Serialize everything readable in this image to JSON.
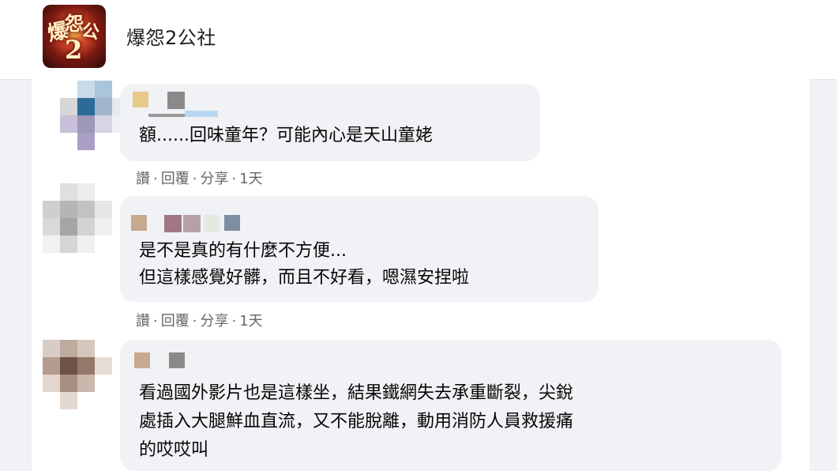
{
  "page": {
    "title": "爆怨2公社",
    "avatar_lettering": "爆怨2公"
  },
  "comments": [
    {
      "text": "額......回味童年？可能內心是天山童姥",
      "actions": {
        "like": "讚",
        "reply": "回覆",
        "share": "分享",
        "time": "1天"
      }
    },
    {
      "text_lines": [
        "是不是真的有什麼不方便...",
        "但這樣感覺好髒，而且不好看，嗯濕安捏啦"
      ],
      "actions": {
        "like": "讚",
        "reply": "回覆",
        "share": "分享",
        "time": "1天"
      }
    },
    {
      "text_lines": [
        "看過國外影片也是這樣坐，結果鐵網失去承重斷裂，尖銳",
        "處插入大腿鮮血直流，又不能脫離，動用消防人員救援痛",
        "的哎哎叫"
      ]
    }
  ],
  "colors": {
    "background": "#f0f2f5",
    "bubble": "#f0f2f5",
    "text": "#050505",
    "meta": "#65676b"
  }
}
